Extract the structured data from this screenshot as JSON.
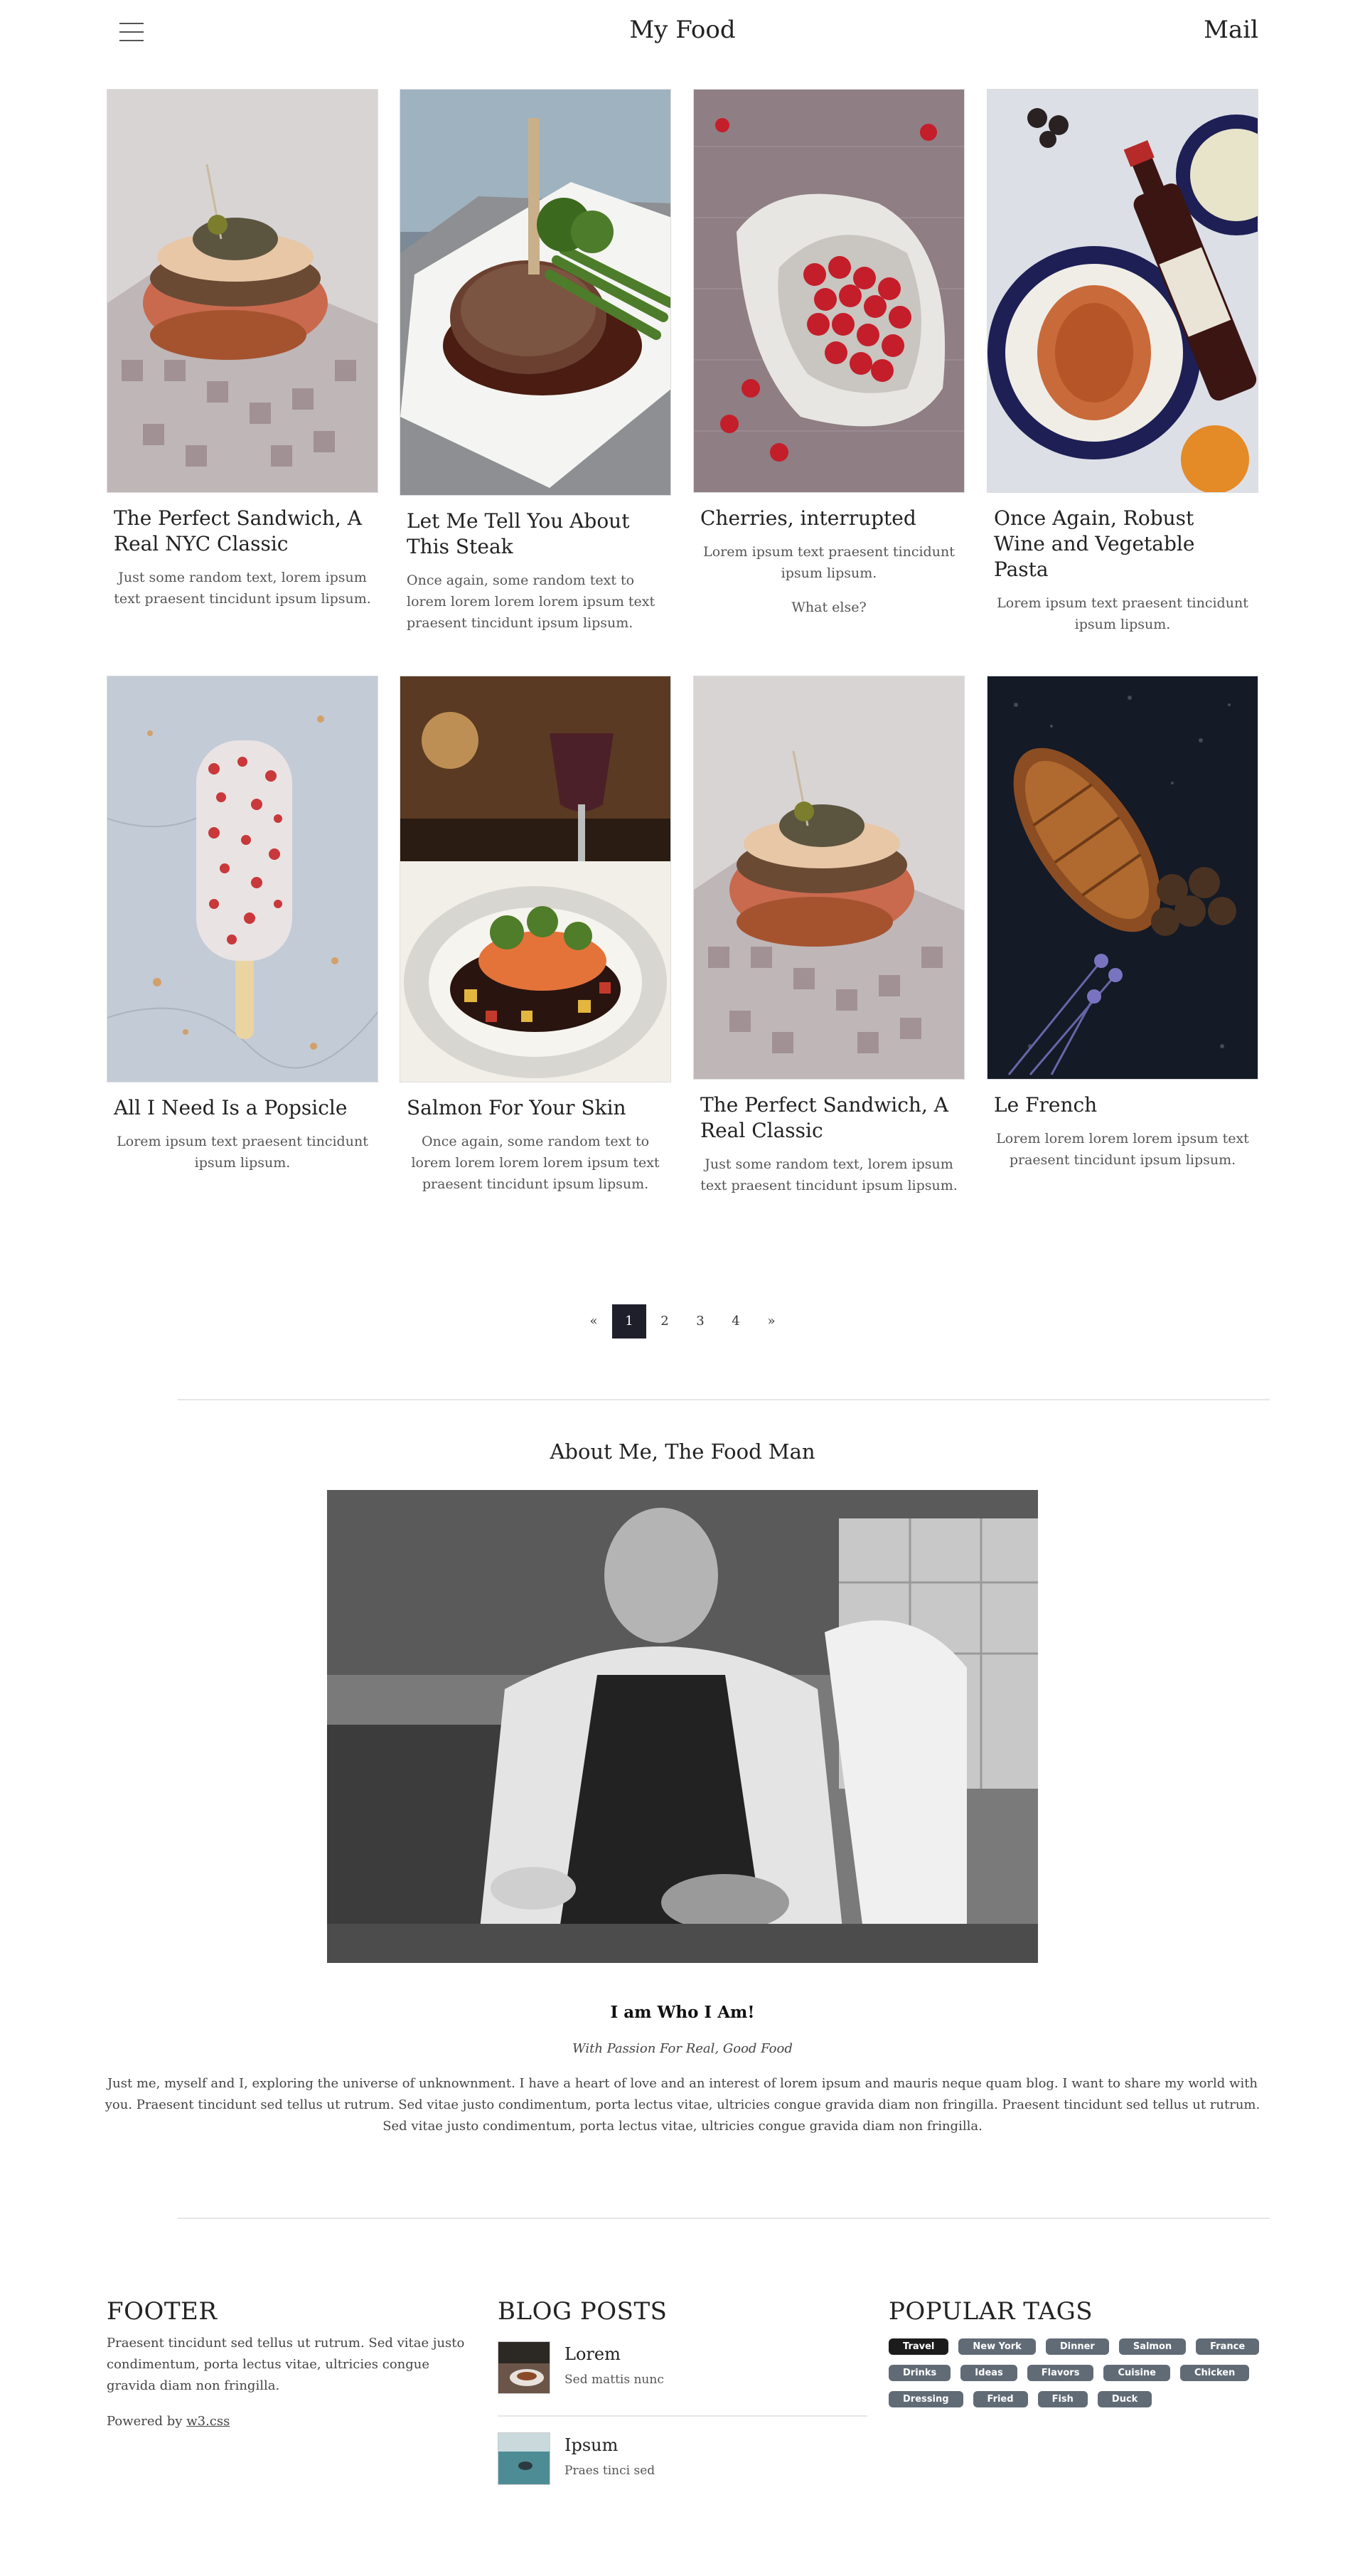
{
  "header": {
    "title": "My Food",
    "mail": "Mail",
    "menu_icon": "hamburger-icon"
  },
  "row1": [
    {
      "title": "The Perfect Sandwich, A Real NYC Classic",
      "text": "Just some random text, lorem ipsum text praesent tincidunt ipsum lipsum.",
      "image": "sandwich"
    },
    {
      "title": "Let Me Tell You About This Steak",
      "text": "Once again, some random text to lorem lorem lorem lorem ipsum text praesent tincidunt ipsum lipsum.",
      "image": "steak"
    },
    {
      "title": "Cherries, interrupted",
      "text": "Lorem ipsum text praesent tincidunt ipsum lipsum.",
      "text2": "What else?",
      "image": "cherries"
    },
    {
      "title": "Once Again, Robust Wine and Vegetable Pasta",
      "text": "Lorem ipsum text praesent tincidunt ipsum lipsum.",
      "image": "wine-pasta"
    }
  ],
  "row2": [
    {
      "title": "All I Need Is a Popsicle",
      "text": "Lorem ipsum text praesent tincidunt ipsum lipsum.",
      "image": "popsicle"
    },
    {
      "title": "Salmon For Your Skin",
      "text": "Once again, some random text to lorem lorem lorem lorem ipsum text praesent tincidunt ipsum lipsum.",
      "image": "salmon"
    },
    {
      "title": "The Perfect Sandwich, A Real Classic",
      "text": "Just some random text, lorem ipsum text praesent tincidunt ipsum lipsum.",
      "image": "sandwich"
    },
    {
      "title": "Le French",
      "text": "Lorem lorem lorem lorem ipsum text praesent tincidunt ipsum lipsum.",
      "image": "croissant"
    }
  ],
  "pagination": {
    "prev": "«",
    "pages": [
      "1",
      "2",
      "3",
      "4"
    ],
    "active": "1",
    "next": "»"
  },
  "about": {
    "title": "About Me, The Food Man",
    "heading": "I am Who I Am!",
    "subheading": "With Passion For Real, Good Food",
    "text": "Just me, myself and I, exploring the universe of unknownment. I have a heart of love and an interest of lorem ipsum and mauris neque quam blog. I want to share my world with you. Praesent tincidunt sed tellus ut rutrum. Sed vitae justo condimentum, porta lectus vitae, ultricies congue gravida diam non fringilla. Praesent tincidunt sed tellus ut rutrum. Sed vitae justo condimentum, porta lectus vitae, ultricies congue gravida diam non fringilla."
  },
  "footer": {
    "col1": {
      "title": "FOOTER",
      "text": "Praesent tincidunt sed tellus ut rutrum. Sed vitae justo condimentum, porta lectus vitae, ultricies congue gravida diam non fringilla.",
      "powered_prefix": "Powered by ",
      "powered_link": "w3.css"
    },
    "col2": {
      "title": "BLOG POSTS",
      "posts": [
        {
          "title": "Lorem",
          "desc": "Sed mattis nunc"
        },
        {
          "title": "Ipsum",
          "desc": "Praes tinci sed"
        }
      ]
    },
    "col3": {
      "title": "POPULAR TAGS",
      "tags": [
        "Travel",
        "New York",
        "Dinner",
        "Salmon",
        "France",
        "Drinks",
        "Ideas",
        "Flavors",
        "Cuisine",
        "Chicken",
        "Dressing",
        "Fried",
        "Fish",
        "Duck"
      ]
    }
  }
}
